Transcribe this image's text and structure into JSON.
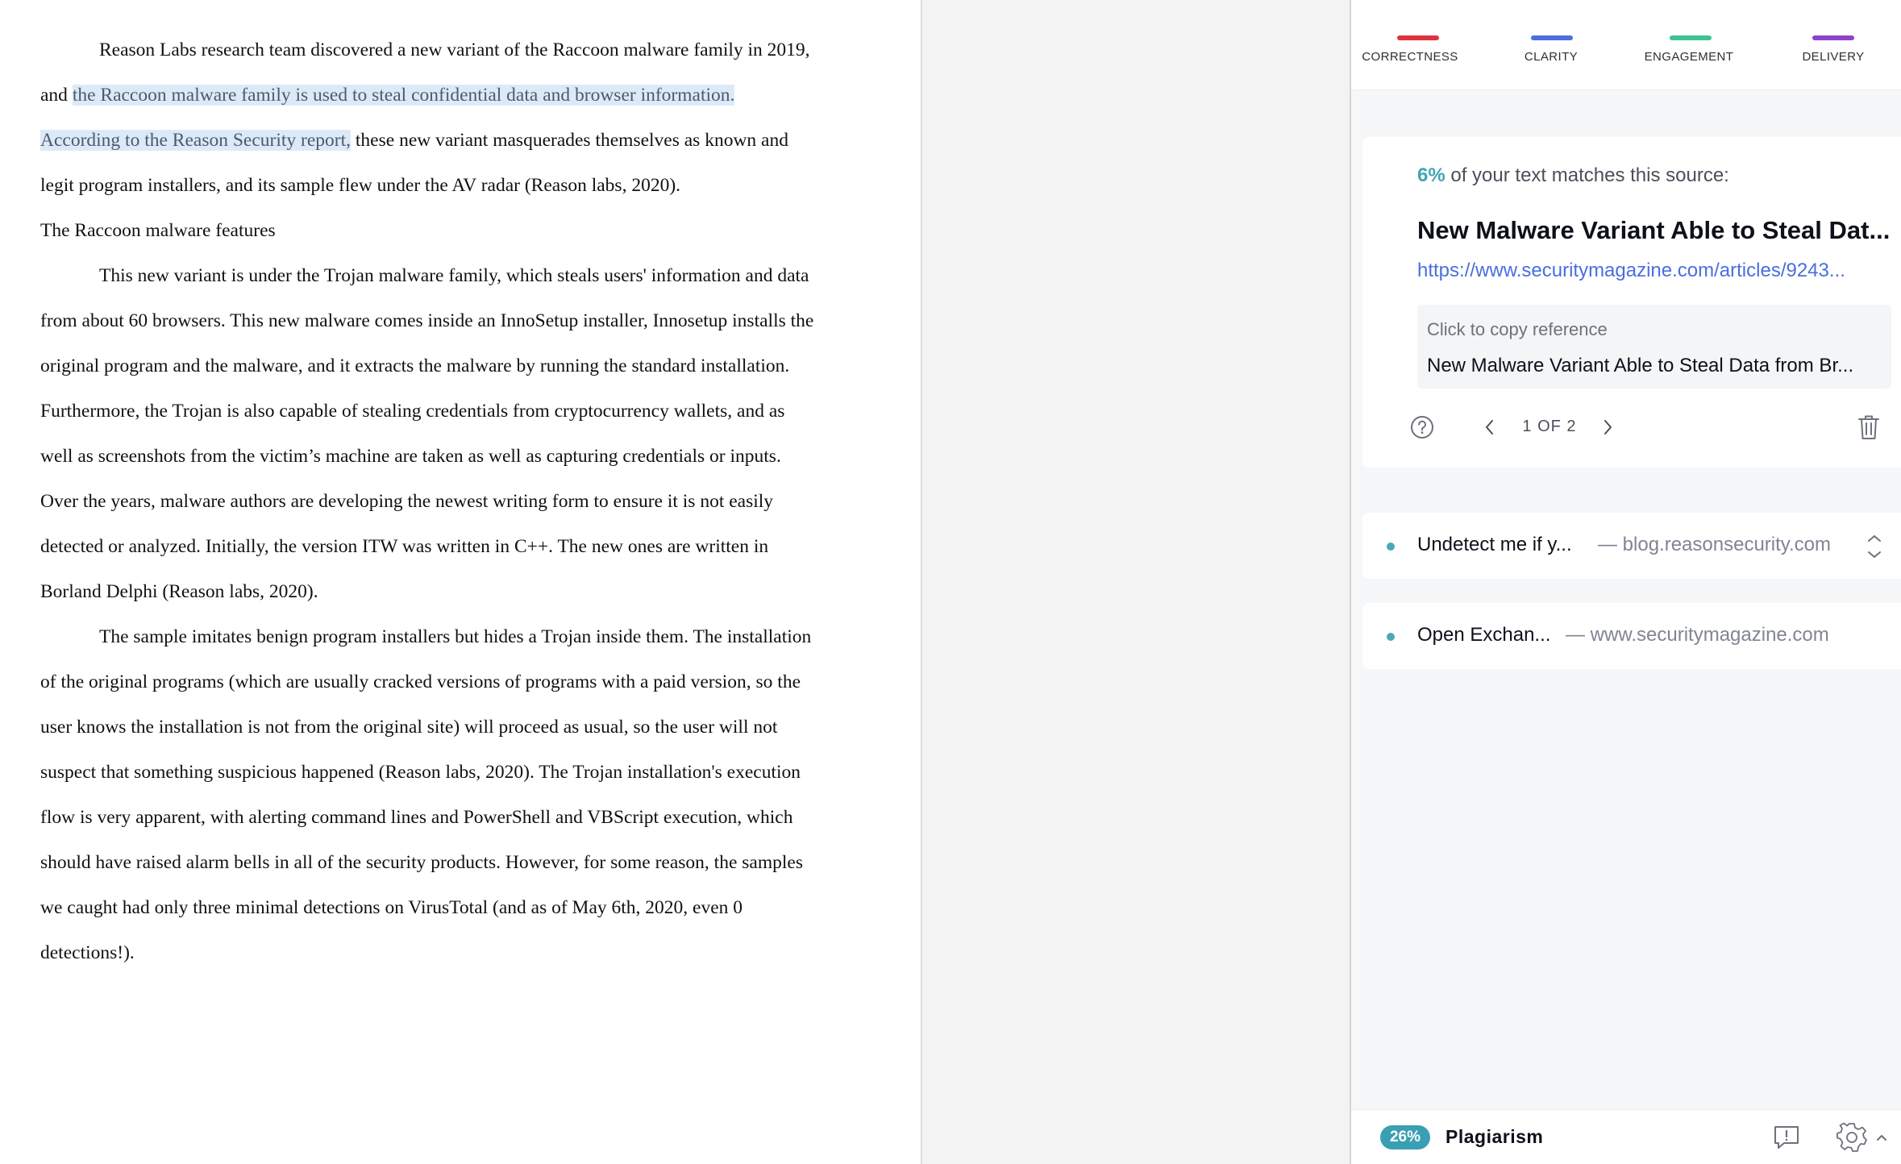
{
  "document": {
    "p1_before": "Reason Labs research team discovered a new variant of the Raccoon malware family in 2019, and ",
    "p1_highlight": "the Raccoon malware family is used to steal confidential data and browser information. According to the Reason Security report,",
    "p1_after": " these new variant masquerades themselves as known and legit program installers, and its sample flew under the AV radar (Reason labs, 2020).",
    "heading": "The Raccoon malware features",
    "p2": "This new variant is under the Trojan malware family, which steals users' information and data from about 60 browsers. This new malware comes inside an InnoSetup installer, Innosetup installs the original program and the malware, and it extracts the malware by running the standard installation. Furthermore, the Trojan is also capable of stealing credentials from cryptocurrency wallets, and as well as screenshots from the victim’s machine are taken as well as capturing credentials or inputs. Over the years, malware authors are developing the newest writing form to ensure it is not easily detected or analyzed. Initially, the version ITW was written in C++. The new ones are written in Borland Delphi (Reason labs, 2020).",
    "p3": "The sample imitates benign program installers but hides a Trojan inside them. The installation of the original programs (which are usually cracked versions of programs with a paid version, so the user knows the installation is not from the original site) will proceed as usual, so the user will not suspect that something suspicious happened (Reason labs, 2020). The Trojan installation's execution flow is very apparent, with alerting command lines and PowerShell and VBScript execution, which should have raised alarm bells in all of the security products. However, for some reason, the samples we caught had only three minimal detections on VirusTotal (and as of May 6th, 2020, even 0 detections!)."
  },
  "sidebar": {
    "tabs": [
      {
        "label": "CORRECTNESS",
        "color": "#e0323f"
      },
      {
        "label": "CLARITY",
        "color": "#4c6ee0"
      },
      {
        "label": "ENGAGEMENT",
        "color": "#3fc28f"
      },
      {
        "label": "DELIVERY",
        "color": "#8d42c8"
      }
    ],
    "card": {
      "match_percent": "6%",
      "match_text": "of your text matches this source:",
      "title": "New Malware Variant Able to Steal Dat...",
      "url": "https://www.securitymagazine.com/articles/9243...",
      "copy_hint": "Click to copy reference",
      "reference": "New Malware Variant Able to Steal Data from Br...",
      "pager": "1 OF 2"
    },
    "sources": [
      {
        "name": "Undetect me if y...",
        "domain": "— blog.reasonsecurity.com"
      },
      {
        "name": "Open Exchan...",
        "domain": "— www.securitymagazine.com"
      }
    ],
    "bottom": {
      "badge": "26%",
      "label": "Plagiarism"
    },
    "icons": {
      "help": "question-circle-icon",
      "prev": "chevron-left-icon",
      "next": "chevron-right-icon",
      "delete": "trash-icon",
      "expand": "chevron-up-down-icon",
      "feedback": "feedback-icon",
      "settings": "gear-icon"
    }
  }
}
